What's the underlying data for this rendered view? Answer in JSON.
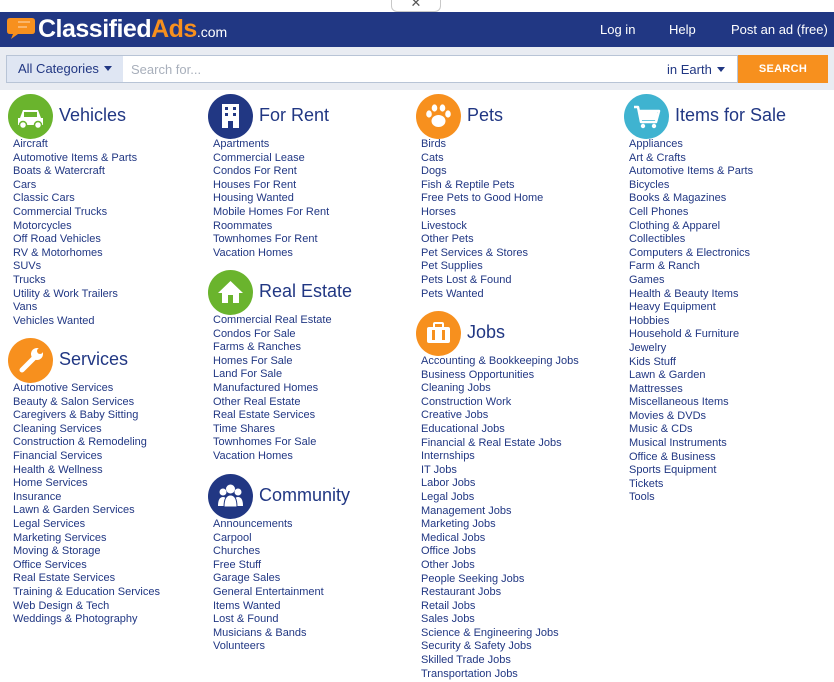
{
  "header": {
    "logo": {
      "main": "Classified",
      "accent": "Ads",
      "suffix": ".com"
    },
    "login": "Log in",
    "help": "Help",
    "post_ad": "Post an ad (free)"
  },
  "search": {
    "category": "All Categories",
    "placeholder": "Search for...",
    "location": "in Earth",
    "button": "SEARCH"
  },
  "colors": {
    "brand_navy": "#213783",
    "accent_orange": "#f7901e",
    "green": "#6ab42d",
    "teal": "#3fb3d0"
  },
  "sections": {
    "vehicles": {
      "title": "Vehicles",
      "icon": "car-icon",
      "items": [
        "Aircraft",
        "Automotive Items & Parts",
        "Boats & Watercraft",
        "Cars",
        "Classic Cars",
        "Commercial Trucks",
        "Motorcycles",
        "Off Road Vehicles",
        "RV & Motorhomes",
        "SUVs",
        "Trucks",
        "Utility & Work Trailers",
        "Vans",
        "Vehicles Wanted"
      ]
    },
    "services": {
      "title": "Services",
      "icon": "wrench-icon",
      "items": [
        "Automotive Services",
        "Beauty & Salon Services",
        "Caregivers & Baby Sitting",
        "Cleaning Services",
        "Construction & Remodeling",
        "Financial Services",
        "Health & Wellness",
        "Home Services",
        "Insurance",
        "Lawn & Garden Services",
        "Legal Services",
        "Marketing Services",
        "Moving & Storage",
        "Office Services",
        "Real Estate Services",
        "Training & Education Services",
        "Web Design & Tech",
        "Weddings & Photography"
      ]
    },
    "for_rent": {
      "title": "For Rent",
      "icon": "building-icon",
      "items": [
        "Apartments",
        "Commercial Lease",
        "Condos For Rent",
        "Houses For Rent",
        "Housing Wanted",
        "Mobile Homes For Rent",
        "Roommates",
        "Townhomes For Rent",
        "Vacation Homes"
      ]
    },
    "real_estate": {
      "title": "Real Estate",
      "icon": "house-icon",
      "items": [
        "Commercial Real Estate",
        "Condos For Sale",
        "Farms & Ranches",
        "Homes For Sale",
        "Land For Sale",
        "Manufactured Homes",
        "Other Real Estate",
        "Real Estate Services",
        "Time Shares",
        "Townhomes For Sale",
        "Vacation Homes"
      ]
    },
    "community": {
      "title": "Community",
      "icon": "people-icon",
      "items": [
        "Announcements",
        "Carpool",
        "Churches",
        "Free Stuff",
        "Garage Sales",
        "General Entertainment",
        "Items Wanted",
        "Lost & Found",
        "Musicians & Bands",
        "Volunteers"
      ]
    },
    "pets": {
      "title": "Pets",
      "icon": "paw-icon",
      "items": [
        "Birds",
        "Cats",
        "Dogs",
        "Fish & Reptile Pets",
        "Free Pets to Good Home",
        "Horses",
        "Livestock",
        "Other Pets",
        "Pet Services & Stores",
        "Pet Supplies",
        "Pets Lost & Found",
        "Pets Wanted"
      ]
    },
    "jobs": {
      "title": "Jobs",
      "icon": "briefcase-icon",
      "items": [
        "Accounting & Bookkeeping Jobs",
        "Business Opportunities",
        "Cleaning Jobs",
        "Construction Work",
        "Creative Jobs",
        "Educational Jobs",
        "Financial & Real Estate Jobs",
        "Internships",
        "IT Jobs",
        "Labor Jobs",
        "Legal Jobs",
        "Management Jobs",
        "Marketing Jobs",
        "Medical Jobs",
        "Office Jobs",
        "Other Jobs",
        "People Seeking Jobs",
        "Restaurant Jobs",
        "Retail Jobs",
        "Sales Jobs",
        "Science & Engineering Jobs",
        "Security & Safety Jobs",
        "Skilled Trade Jobs",
        "Transportation Jobs"
      ]
    },
    "items_for_sale": {
      "title": "Items for Sale",
      "icon": "cart-icon",
      "items": [
        "Appliances",
        "Art & Crafts",
        "Automotive Items & Parts",
        "Bicycles",
        "Books & Magazines",
        "Cell Phones",
        "Clothing & Apparel",
        "Collectibles",
        "Computers & Electronics",
        "Farm & Ranch",
        "Games",
        "Health & Beauty Items",
        "Heavy Equipment",
        "Hobbies",
        "Household & Furniture",
        "Jewelry",
        "Kids Stuff",
        "Lawn & Garden",
        "Mattresses",
        "Miscellaneous Items",
        "Movies & DVDs",
        "Music & CDs",
        "Musical Instruments",
        "Office & Business",
        "Sports Equipment",
        "Tickets",
        "Tools"
      ]
    }
  }
}
